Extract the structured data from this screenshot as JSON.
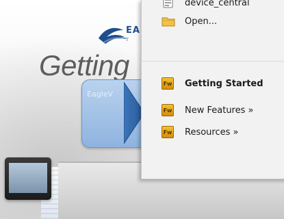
{
  "slide": {
    "logo_text": "EA",
    "logo_subtext": "T",
    "title": "Getting",
    "callout_label": "EagleV"
  },
  "menu": {
    "recent_file_label": "device_central",
    "open_label": "Open...",
    "getting_started_label": "Getting Started",
    "new_features_label": "New Features »",
    "resources_label": "Resources »",
    "fw_icon_text": "Fw"
  },
  "colors": {
    "menu_bg": "#f2f2f2",
    "fw_icon": "#e0a11f",
    "folder_icon": "#f1c24a",
    "callout": "#9fc0e6",
    "logo_blue": "#1e4f8c"
  },
  "icons": {
    "recent_file": "document-icon",
    "open": "folder-icon",
    "fw": "fireworks-app-icon",
    "play": "play-icon",
    "logo": "eagle-logo-icon"
  }
}
